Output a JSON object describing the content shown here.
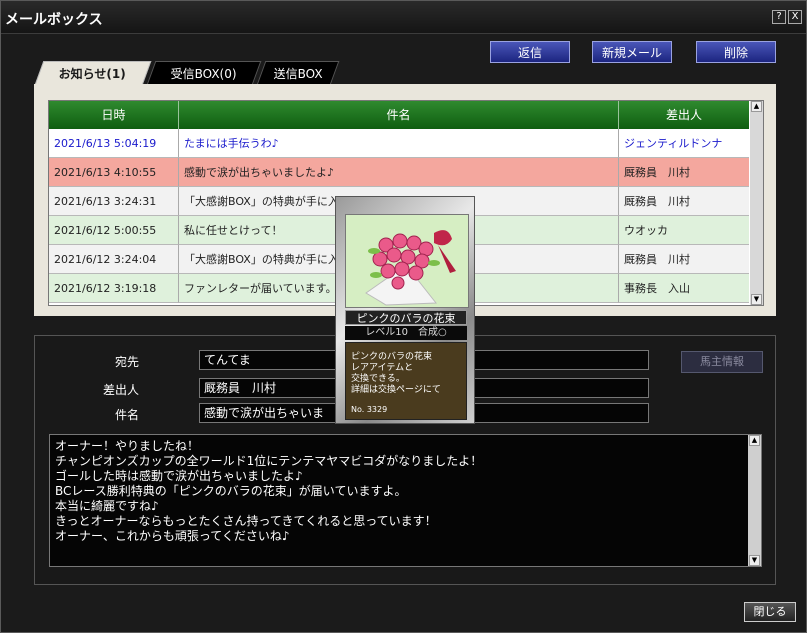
{
  "window": {
    "title": "メールボックス",
    "help_icon": "?",
    "close_icon": "X"
  },
  "toolbar": {
    "reply": "返信",
    "new_mail": "新規メール",
    "delete": "削除"
  },
  "tabs": [
    {
      "label": "お知らせ(1)",
      "active": true
    },
    {
      "label": "受信BOX(0)",
      "active": false
    },
    {
      "label": "送信BOX",
      "active": false
    }
  ],
  "table": {
    "headers": {
      "date": "日時",
      "subject": "件名",
      "sender": "差出人"
    },
    "rows": [
      {
        "date": "2021/6/13 5:04:19",
        "subject": "たまには手伝うわ♪",
        "sender": "ジェンティルドンナ",
        "unread": true,
        "bg": "#ffffff"
      },
      {
        "date": "2021/6/13 4:10:55",
        "subject": "感動で涙が出ちゃいましたよ♪",
        "sender": "厩務員　川村",
        "unread": false,
        "bg": "#f4a79e"
      },
      {
        "date": "2021/6/13 3:24:31",
        "subject": "「大感謝BOX」の特典が手に入りました！",
        "sender": "厩務員　川村",
        "unread": false,
        "bg": "#f2f2f2"
      },
      {
        "date": "2021/6/12 5:00:55",
        "subject": "私に任せとけって！",
        "sender": "ウオッカ",
        "unread": false,
        "bg": "#dff1dc"
      },
      {
        "date": "2021/6/12 3:24:04",
        "subject": "「大感謝BOX」の特典が手に入",
        "sender": "厩務員　川村",
        "unread": false,
        "bg": "#f2f2f2"
      },
      {
        "date": "2021/6/12 3:19:18",
        "subject": "ファンレターが届いています。",
        "sender": "事務長　入山",
        "unread": false,
        "bg": "#dff1dc"
      }
    ]
  },
  "detail": {
    "to_label": "宛先",
    "to_value": "てんてま",
    "from_label": "差出人",
    "from_value": "厩務員　川村",
    "subject_label": "件名",
    "subject_value": "感動で涙が出ちゃいま",
    "owner_info_button": "馬主情報",
    "body": [
      "オーナー！やりましたね！",
      "チャンピオンズカップの全ワールド1位にテンテマヤマビコダがなりましたよ！",
      "ゴールした時は感動で涙が出ちゃいましたよ♪",
      "BCレース勝利特典の「ピンクのバラの花束」が届いていますよ。",
      "本当に綺麗ですね♪",
      "きっとオーナーならもっとたくさん持ってきてくれると思っています！",
      "オーナー、これからも頑張ってくださいね♪"
    ]
  },
  "tooltip": {
    "item_name": "ピンクのバラの花束",
    "level_text": "レベル10　合成○",
    "description": [
      "ピンクのバラの花束",
      "レアアイテムと",
      "交換できる。",
      "詳細は交換ページにて"
    ],
    "number": "No. 3329"
  },
  "footer": {
    "close": "閉じる"
  },
  "colors": {
    "header_green": "#1f7a1f",
    "button_blue": "#2a3596",
    "unread_text": "#1a1acc",
    "highlight_row": "#f4a79e",
    "alt_row_green": "#dff1dc"
  }
}
